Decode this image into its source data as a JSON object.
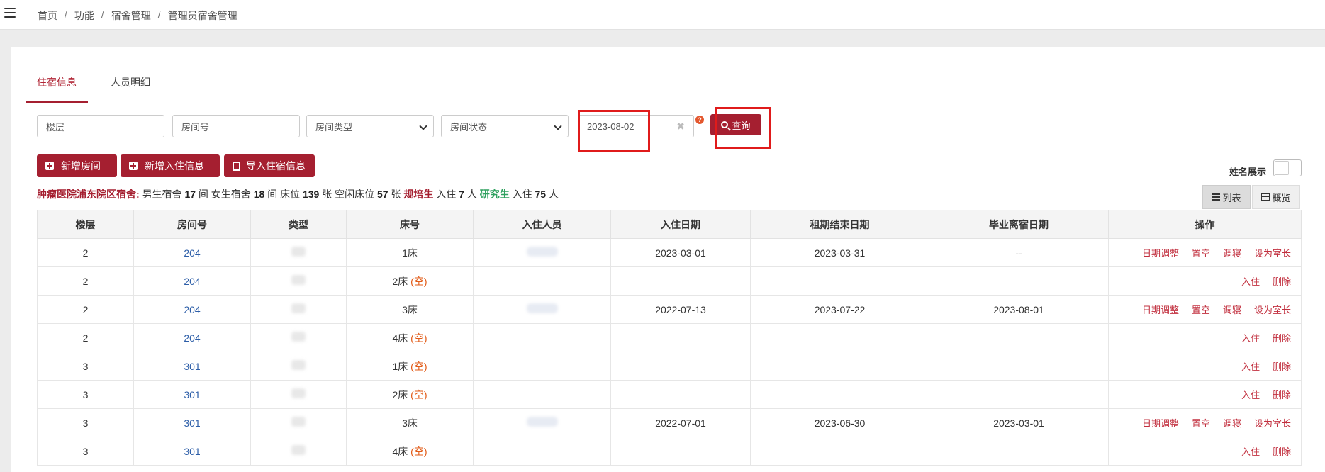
{
  "breadcrumb": [
    "首页",
    "功能",
    "宿舍管理",
    "管理员宿舍管理"
  ],
  "tabs": [
    {
      "label": "住宿信息",
      "active": true
    },
    {
      "label": "人员明细",
      "active": false
    }
  ],
  "filters": {
    "floor_placeholder": "楼层",
    "room_placeholder": "房间号",
    "room_type": "房间类型",
    "room_status": "房间状态",
    "date_value": "2023-08-02",
    "clear_glyph": "✖",
    "help_glyph": "?",
    "search_label": "查询"
  },
  "actions": {
    "add_room": "新增房间",
    "add_checkin": "新增入住信息",
    "import_checkin": "导入住宿信息"
  },
  "name_toggle_label": "姓名展示",
  "view": {
    "list_label": "列表",
    "grid_label": "概览"
  },
  "summary": {
    "campus": "肿瘤医院浦东院区宿舍:",
    "t1": "男生宿舍",
    "male_rooms": "17",
    "t2": "间 女生宿舍",
    "female_rooms": "18",
    "t3": "间 床位",
    "beds": "139",
    "t4": "张 空闲床位",
    "free_beds": "57",
    "t5": "张",
    "trainee": "规培生",
    "t6": "入住",
    "trainee_count": "7",
    "t7": "人",
    "grad": "研究生",
    "t8": "入住",
    "grad_count": "75",
    "t9": "人"
  },
  "table": {
    "headers": [
      "楼层",
      "房间号",
      "类型",
      "床号",
      "入住人员",
      "入住日期",
      "租期结束日期",
      "毕业离宿日期",
      "操作"
    ],
    "empty_tag": "(空)",
    "rows": [
      {
        "floor": "2",
        "room": "204",
        "bed": "1床",
        "empty": false,
        "checkin": "2023-03-01",
        "lease_end": "2023-03-31",
        "leave": "--",
        "ops": [
          "日期调整",
          "置空",
          "调寝",
          "设为室长"
        ]
      },
      {
        "floor": "2",
        "room": "204",
        "bed": "2床",
        "empty": true,
        "checkin": "",
        "lease_end": "",
        "leave": "",
        "ops": [
          "入住",
          "删除"
        ]
      },
      {
        "floor": "2",
        "room": "204",
        "bed": "3床",
        "empty": false,
        "checkin": "2022-07-13",
        "lease_end": "2023-07-22",
        "leave": "2023-08-01",
        "ops": [
          "日期调整",
          "置空",
          "调寝",
          "设为室长"
        ]
      },
      {
        "floor": "2",
        "room": "204",
        "bed": "4床",
        "empty": true,
        "checkin": "",
        "lease_end": "",
        "leave": "",
        "ops": [
          "入住",
          "删除"
        ]
      },
      {
        "floor": "3",
        "room": "301",
        "bed": "1床",
        "empty": true,
        "checkin": "",
        "lease_end": "",
        "leave": "",
        "ops": [
          "入住",
          "删除"
        ]
      },
      {
        "floor": "3",
        "room": "301",
        "bed": "2床",
        "empty": true,
        "checkin": "",
        "lease_end": "",
        "leave": "",
        "ops": [
          "入住",
          "删除"
        ]
      },
      {
        "floor": "3",
        "room": "301",
        "bed": "3床",
        "empty": true,
        "checkin": "2022-07-01",
        "lease_end": "2023-06-30",
        "leave": "2023-03-01",
        "ops": [
          "日期调整",
          "置空",
          "调寝",
          "设为室长"
        ]
      },
      {
        "floor": "3",
        "room": "301",
        "bed": "4床",
        "empty": true,
        "checkin": "",
        "lease_end": "",
        "leave": "",
        "ops": [
          "入住",
          "删除"
        ]
      }
    ]
  },
  "colors": {
    "brand": "#a51f30",
    "link": "#2d5ea8",
    "empty": "#e25a16",
    "highlight": "#e01b1b"
  }
}
